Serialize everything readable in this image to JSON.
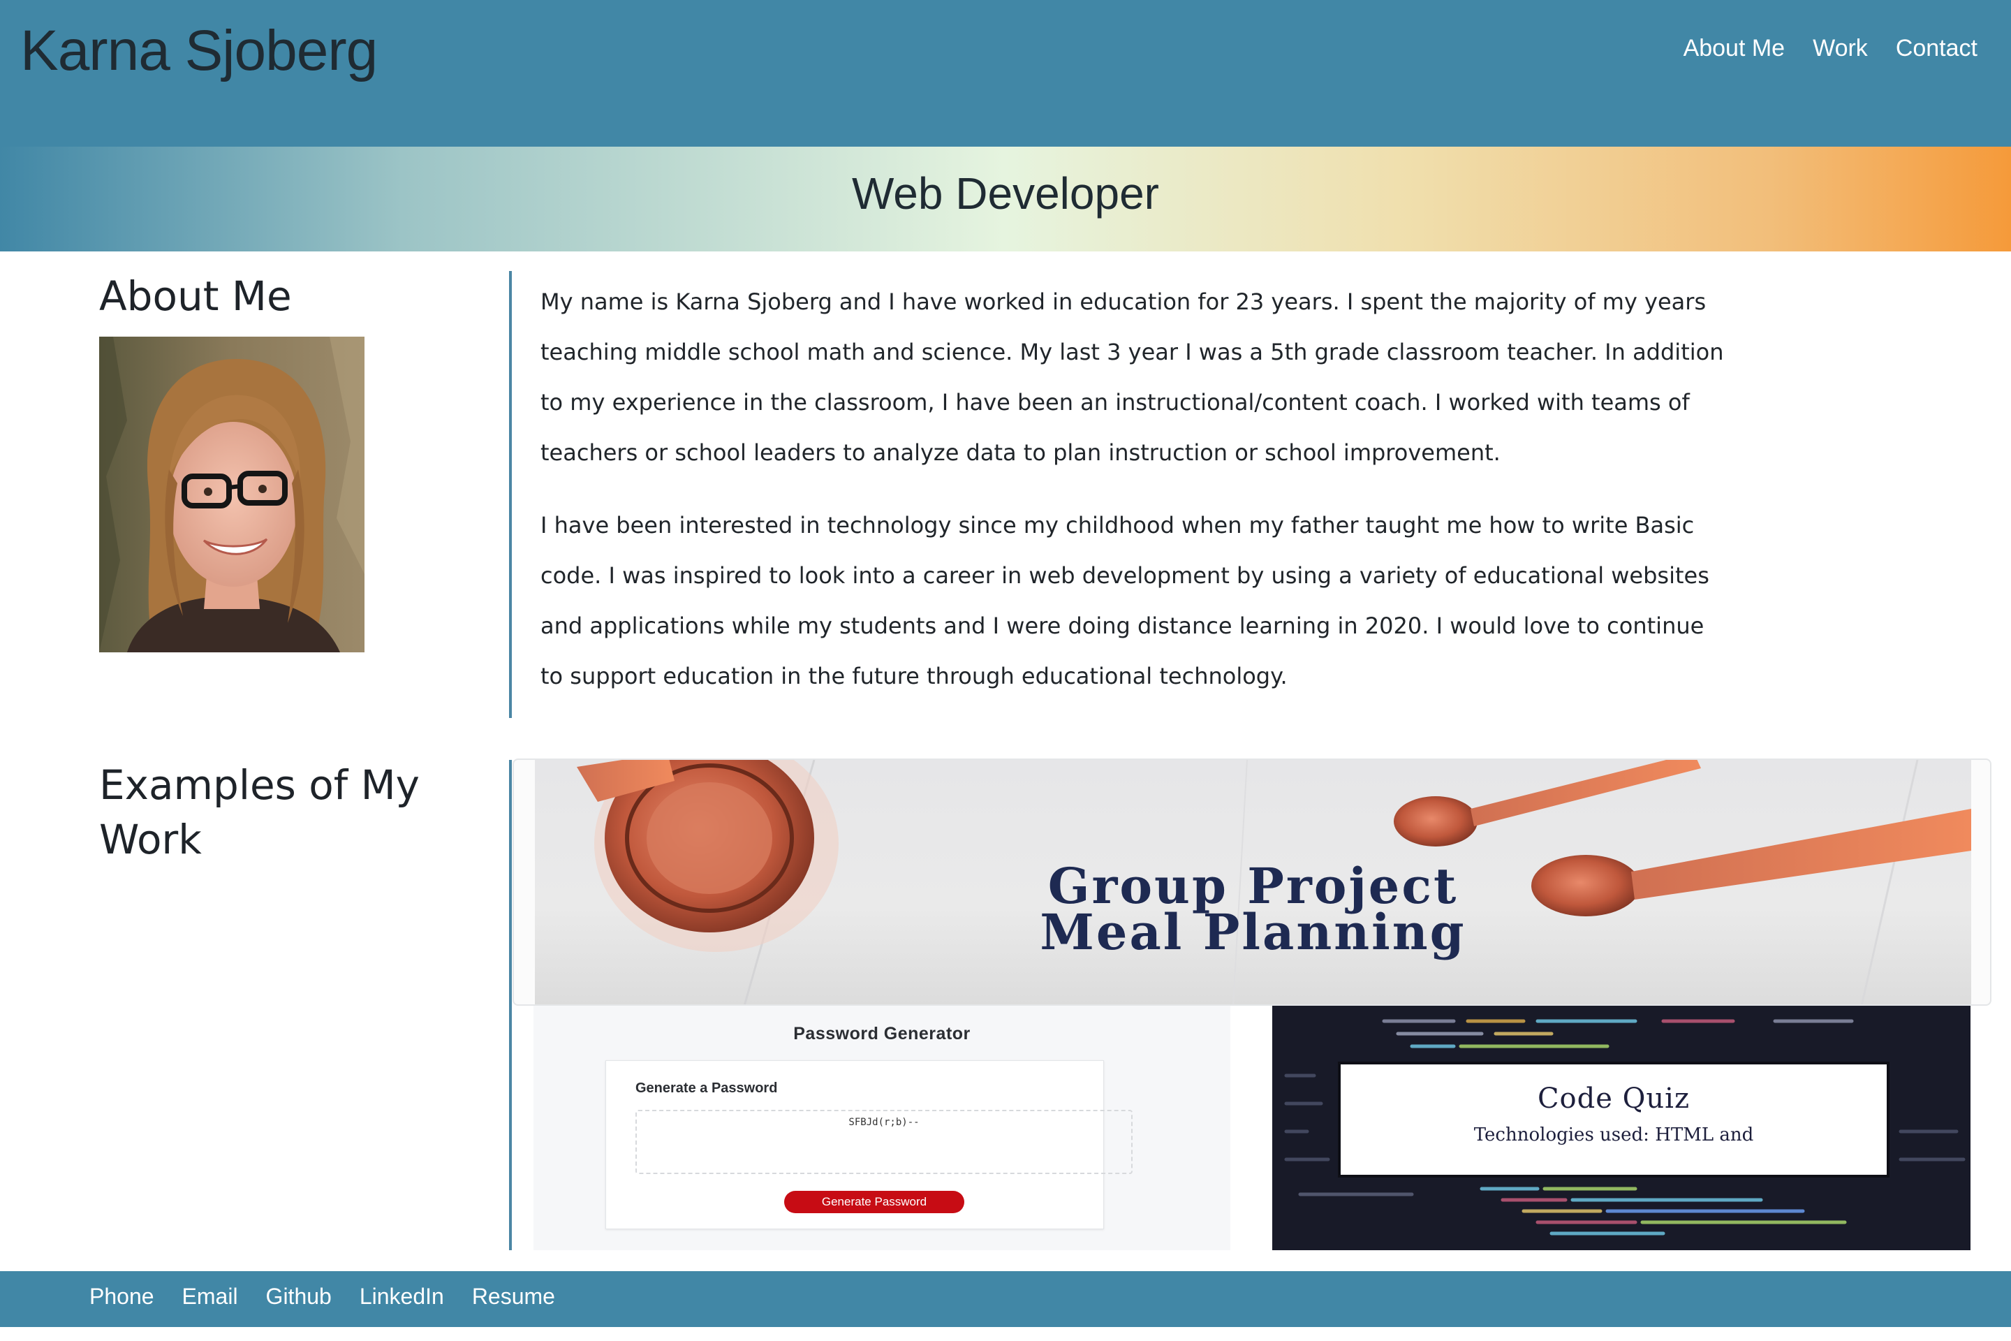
{
  "header": {
    "title": "Karna Sjoberg",
    "nav": [
      {
        "label": "About Me"
      },
      {
        "label": "Work"
      },
      {
        "label": "Contact"
      }
    ]
  },
  "hero": {
    "title": "Web Developer"
  },
  "about": {
    "heading": "About Me",
    "paragraphs": [
      "My name is Karna Sjoberg and I have worked in education for 23 years. I spent the majority of my years teaching middle school math and science. My last 3 year I was a 5th grade classroom teacher. In addition to my experience in the classroom, I have been an instructional/content coach. I worked with teams of teachers or school leaders to analyze data to plan instruction or school improvement.",
      "I have been interested in technology since my childhood when my father taught me how to write Basic code. I was inspired to look into a career in web development by using a variety of educational websites and applications while my students and I were doing distance learning in 2020. I would love to continue to support education in the future through educational technology."
    ]
  },
  "work": {
    "heading": "Examples of My Work",
    "projects": [
      {
        "title_line1": "Group Project",
        "title_line2": "Meal Planning"
      },
      {
        "title": "Password Generator",
        "subtitle": "Generate a Password",
        "output": "SFBJd(r;b)--",
        "button": "Generate Password"
      },
      {
        "title": "Code Quiz",
        "subtitle": "Technologies used: HTML and"
      }
    ]
  },
  "footer": {
    "links": [
      {
        "label": "Phone"
      },
      {
        "label": "Email"
      },
      {
        "label": "Github"
      },
      {
        "label": "LinkedIn"
      },
      {
        "label": "Resume"
      }
    ]
  },
  "colors": {
    "header_bg": "#4187a6",
    "accent_orange": "#f59a3a",
    "divider": "#4b86a4",
    "button_red": "#c70c14"
  }
}
